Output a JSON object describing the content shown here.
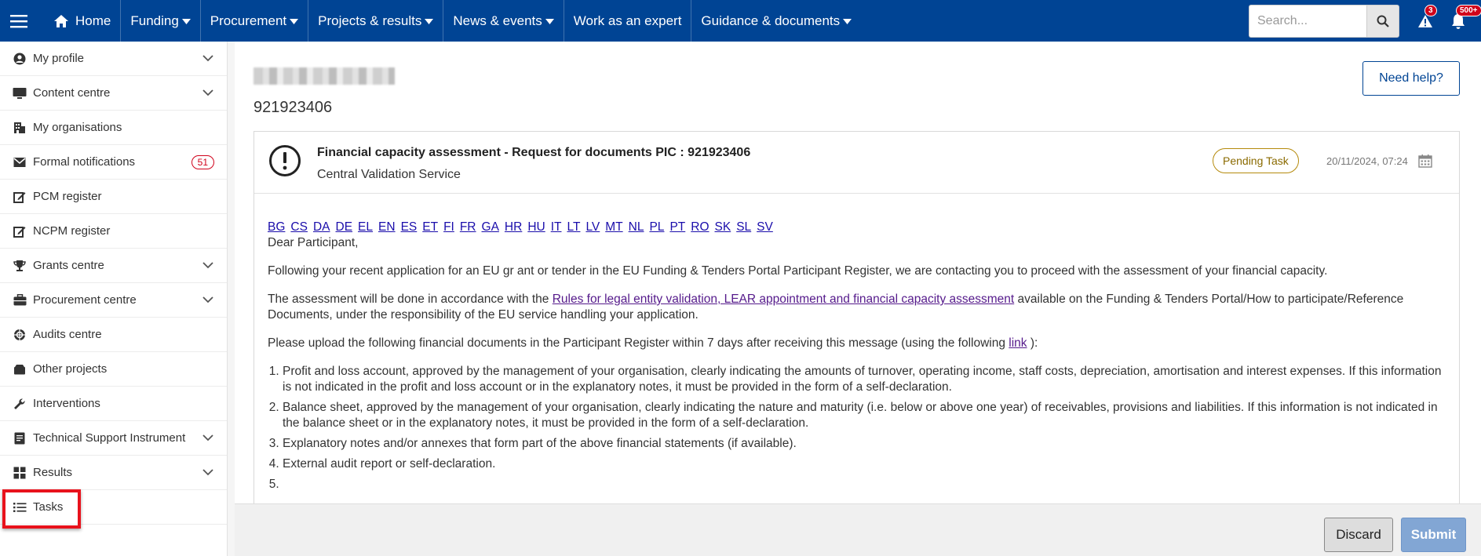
{
  "topnav": {
    "home": "Home",
    "items": [
      {
        "label": "Funding",
        "dropdown": true
      },
      {
        "label": "Procurement",
        "dropdown": true
      },
      {
        "label": "Projects & results",
        "dropdown": true
      },
      {
        "label": "News & events",
        "dropdown": true
      },
      {
        "label": "Work as an expert",
        "dropdown": false
      },
      {
        "label": "Guidance & documents",
        "dropdown": true
      }
    ],
    "search_placeholder": "Search...",
    "alerts_count": "3",
    "notifications_count": "500+"
  },
  "sidebar": {
    "items": [
      {
        "label": "My profile",
        "icon": "user-circle-icon",
        "chevron": true
      },
      {
        "label": "Content centre",
        "icon": "monitor-icon",
        "chevron": true
      },
      {
        "label": "My organisations",
        "icon": "building-icon",
        "chevron": false
      },
      {
        "label": "Formal notifications",
        "icon": "envelope-icon",
        "chevron": false,
        "badge": "51"
      },
      {
        "label": "PCM register",
        "icon": "edit-icon",
        "chevron": false
      },
      {
        "label": "NCPM register",
        "icon": "edit-icon",
        "chevron": false
      },
      {
        "label": "Grants centre",
        "icon": "trophy-icon",
        "chevron": true
      },
      {
        "label": "Procurement centre",
        "icon": "briefcase-icon",
        "chevron": true
      },
      {
        "label": "Audits centre",
        "icon": "crosshair-icon",
        "chevron": false
      },
      {
        "label": "Other projects",
        "icon": "box-icon",
        "chevron": false
      },
      {
        "label": "Interventions",
        "icon": "wrench-icon",
        "chevron": false
      },
      {
        "label": "Technical Support Instrument",
        "icon": "document-icon",
        "chevron": true
      },
      {
        "label": "Results",
        "icon": "grid-icon",
        "chevron": true
      },
      {
        "label": "Tasks",
        "icon": "list-icon",
        "chevron": false
      }
    ]
  },
  "main": {
    "pic": "921923406",
    "help_label": "Need help?",
    "task": {
      "title": "Financial capacity assessment - Request for documents PIC : 921923406",
      "subtitle": "Central Validation Service",
      "status": "Pending Task",
      "date": "20/11/2024, 07:24"
    },
    "languages": [
      "BG",
      "CS",
      "DA",
      "DE",
      "EL",
      "EN",
      "ES",
      "ET",
      "FI",
      "FR",
      "GA",
      "HR",
      "HU",
      "IT",
      "LT",
      "LV",
      "MT",
      "NL",
      "PL",
      "PT",
      "RO",
      "SK",
      "SL",
      "SV"
    ],
    "greeting": "Dear Participant,",
    "para1": "Following your recent application for an EU gr ant or tender in the EU Funding & Tenders Portal Participant Register, we are contacting you to proceed with the assessment of your financial capacity.",
    "para2_before": "The assessment will be done in accordance with the ",
    "para2_link": "Rules for legal entity validation, LEAR appointment and financial capacity assessment",
    "para2_after": " available on the Funding & Tenders Portal/How to participate/Reference Documents, under the responsibility of the EU service handling your application.",
    "para3_before": "Please upload the following financial documents in the Participant Register within 7 days after receiving this message (using the following ",
    "para3_link": "link",
    "para3_after": " ):",
    "documents": [
      "Profit and loss account, approved by the management of your organisation, clearly indicating the amounts of turnover, operating income, staff costs, depreciation, amortisation and interest expenses. If this information is not indicated in the profit and loss account or in the explanatory notes, it must be provided in the form of a self-declaration.",
      "Balance sheet, approved by the management of your organisation, clearly indicating the nature and maturity (i.e. below or above one year) of receivables, provisions and liabilities. If this information is not indicated in the balance sheet or in the explanatory notes, it must be provided in the form of a self-declaration.",
      "Explanatory notes and/or annexes that form part of the above financial statements (if available).",
      "External audit report or self-declaration.",
      ""
    ]
  },
  "footer": {
    "discard_label": "Discard",
    "submit_label": "Submit"
  },
  "colors": {
    "brand": "#004494",
    "alert": "#d0021b",
    "pending": "#b58a0c",
    "highlight": "#e8121c"
  }
}
